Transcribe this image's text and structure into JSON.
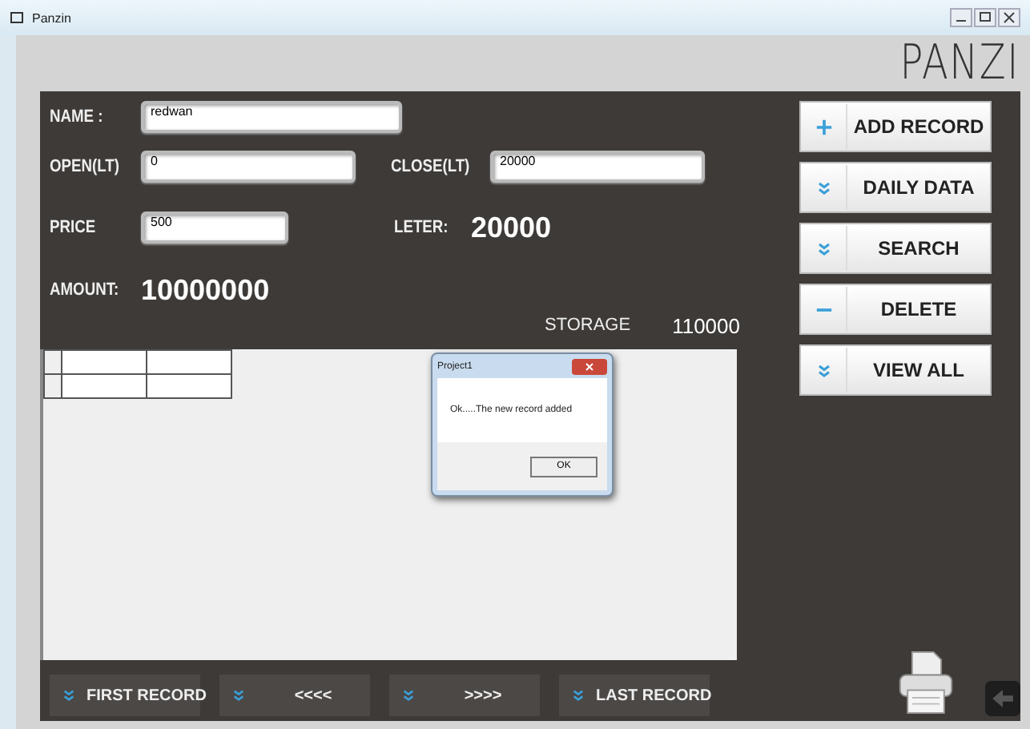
{
  "window": {
    "title": "Panzin"
  },
  "app_title": "PANZI",
  "form": {
    "name": {
      "label": "NAME :",
      "value": "redwan"
    },
    "open": {
      "label": "OPEN(LT)",
      "value": "0"
    },
    "close": {
      "label": "CLOSE(LT)",
      "value": "20000"
    },
    "price": {
      "label": "PRICE",
      "value": "500"
    },
    "leter": {
      "label": "LETER:",
      "value": "20000"
    },
    "amount": {
      "label": "AMOUNT:",
      "value": "10000000"
    },
    "storage": {
      "label": "STORAGE",
      "value": "110000"
    }
  },
  "side_buttons": [
    {
      "label": "ADD RECORD",
      "kind": "plus"
    },
    {
      "label": "DAILY DATA",
      "kind": "chevron"
    },
    {
      "label": "SEARCH",
      "kind": "chevron"
    },
    {
      "label": "DELETE",
      "kind": "minus"
    },
    {
      "label": "VIEW ALL",
      "kind": "chevron"
    }
  ],
  "nav_buttons": [
    "FIRST RECORD",
    "<<<<",
    ">>>>",
    "LAST RECORD"
  ],
  "dialog": {
    "title": "Project1",
    "message": "Ok.....The new record added",
    "button": "OK"
  }
}
